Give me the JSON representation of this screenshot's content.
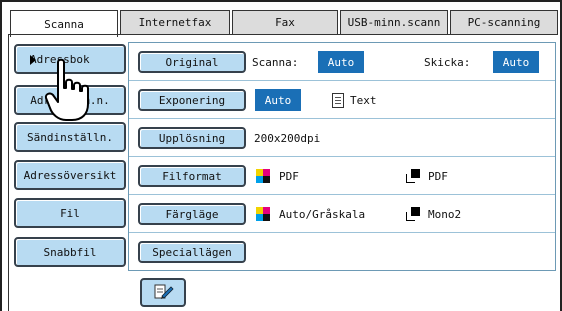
{
  "tabs": [
    {
      "label": "Scanna",
      "active": true
    },
    {
      "label": "Internetfax"
    },
    {
      "label": "Fax"
    },
    {
      "label": "USB-minn.scann"
    },
    {
      "label": "PC-scanning"
    }
  ],
  "sidebar": {
    "items": [
      {
        "label": "Adressbok"
      },
      {
        "label": "Adressinm.n."
      },
      {
        "label": "Sändinställn."
      },
      {
        "label": "Adressöversikt"
      },
      {
        "label": "Fil"
      },
      {
        "label": "Snabbfil"
      }
    ]
  },
  "settings": {
    "original": {
      "label": "Original",
      "scan_label": "Scanna:",
      "scan_value": "Auto",
      "send_label": "Skicka:",
      "send_value": "Auto"
    },
    "exposure": {
      "label": "Exponering",
      "value": "Auto",
      "mode": "Text"
    },
    "resolution": {
      "label": "Upplösning",
      "value": "200x200dpi"
    },
    "file_format": {
      "label": "Filformat",
      "color_format": "PDF",
      "mono_format": "PDF"
    },
    "color_mode": {
      "label": "Färgläge",
      "color_value": "Auto/Gråskala",
      "mono_value": "Mono2"
    },
    "special": {
      "label": "Speciallägen"
    }
  },
  "colors": {
    "button_fill": "#b8dbf2",
    "auto_fill": "#1a6fb6",
    "panel_border": "#6d9ab5"
  },
  "icons": {
    "bottom_button": "edit-pen-icon",
    "pointer": "hand-pointer-icon"
  }
}
